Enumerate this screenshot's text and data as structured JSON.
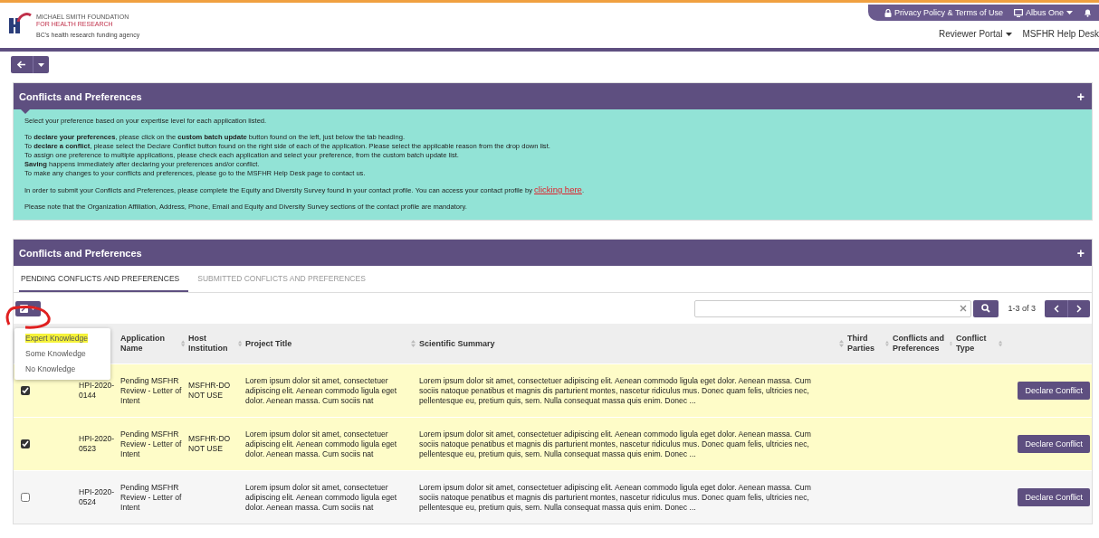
{
  "header": {
    "logo": {
      "line1": "MICHAEL SMITH FOUNDATION",
      "line2": "FOR HEALTH RESEARCH",
      "tagline": "BC's health research funding agency"
    },
    "top_links": [
      {
        "label": "Privacy Policy & Terms of Use",
        "dropdown": false
      },
      {
        "label": "Albus One",
        "dropdown": true
      }
    ],
    "nav": [
      {
        "label": "Reviewer Portal",
        "dropdown": true
      },
      {
        "label": "MSFHR Help Desk",
        "dropdown": false
      }
    ]
  },
  "info_panel": {
    "title": "Conflicts and Preferences",
    "expand": "+",
    "blocks": [
      {
        "lines": [
          "Select your preference based on your expertise level for each application listed."
        ]
      },
      {
        "lines": [
          "To **declare your preferences**, please click on the **custom batch update** button found on the left, just below the tab heading.",
          "To **declare a conflict**, please select the Declare Conflict button found on the right side of each of the application. Please select the applicable reason from the drop down list.",
          "To assign one preference to multiple applications, please check each application and select your preference, from the custom batch update list.",
          "**Saving** happens immediately after declaring your preferences and/or conflict.",
          "To make any changes to your conflicts and preferences, please go to the MSFHR Help Desk page to contact us."
        ]
      },
      {
        "lines": [
          "In order to submit your Conflicts and Preferences, please complete the Equity and Diversity Survey found in your contact profile. You can access your contact profile by "
        ],
        "link": "clicking here",
        "after": "."
      },
      {
        "lines": [
          "Please note that the Organization Affiliation, Address, Phone, Email and Equity and Diversity Survey sections of the contact profile are mandatory."
        ]
      }
    ]
  },
  "table_panel": {
    "title": "Conflicts and Preferences",
    "expand": "+",
    "tabs": [
      {
        "label": "PENDING CONFLICTS AND PREFERENCES",
        "selected": true
      },
      {
        "label": "SUBMITTED CONFLICTS AND PREFERENCES",
        "selected": false
      }
    ],
    "batch_menu": [
      {
        "label": "Expert Knowledge",
        "highlighted": true
      },
      {
        "label": "Some Knowledge",
        "highlighted": false
      },
      {
        "label": "No Knowledge",
        "highlighted": false
      }
    ],
    "pager": "1-3 of 3",
    "columns": [
      "Application Name",
      "Host Institution",
      "Project Title",
      "Scientific Summary",
      "Third Parties",
      "Conflicts and Preferences",
      "Conflict Type"
    ],
    "rows": [
      {
        "checked": true,
        "id": "HPI-2020-0144",
        "application": "Pending MSFHR Review - Letter of Intent",
        "host": "MSFHR-DO NOT USE",
        "title": "Lorem ipsum dolor sit amet, consectetuer adipiscing elit. Aenean commodo ligula eget dolor. Aenean massa. Cum sociis nat",
        "summary": "Lorem ipsum dolor sit amet, consectetuer adipiscing elit. Aenean commodo ligula eget dolor. Aenean massa. Cum sociis natoque penatibus et magnis dis parturient montes, nascetur ridiculus mus. Donec quam felis, ultricies nec, pellentesque eu, pretium quis, sem. Nulla consequat massa quis enim. Donec ...",
        "action": "Declare Conflict"
      },
      {
        "checked": true,
        "id": "HPI-2020-0523",
        "application": "Pending MSFHR Review - Letter of Intent",
        "host": "MSFHR-DO NOT USE",
        "title": "Lorem ipsum dolor sit amet, consectetuer adipiscing elit. Aenean commodo ligula eget dolor. Aenean massa. Cum sociis nat",
        "summary": "Lorem ipsum dolor sit amet, consectetuer adipiscing elit. Aenean commodo ligula eget dolor. Aenean massa. Cum sociis natoque penatibus et magnis dis parturient montes, nascetur ridiculus mus. Donec quam felis, ultricies nec, pellentesque eu, pretium quis, sem. Nulla consequat massa quis enim. Donec ...",
        "action": "Declare Conflict"
      },
      {
        "checked": false,
        "id": "HPI-2020-0524",
        "application": "Pending MSFHR Review - Letter of Intent",
        "host": "",
        "title": "Lorem ipsum dolor sit amet, consectetuer adipiscing elit. Aenean commodo ligula eget dolor. Aenean massa. Cum sociis nat",
        "summary": "Lorem ipsum dolor sit amet, consectetuer adipiscing elit. Aenean commodo ligula eget dolor. Aenean massa. Cum sociis natoque penatibus et magnis dis parturient montes, nascetur ridiculus mus. Donec quam felis, ultricies nec, pellentesque eu, pretium quis, sem. Nulla consequat massa quis enim. Donec ...",
        "action": "Declare Conflict"
      }
    ]
  }
}
